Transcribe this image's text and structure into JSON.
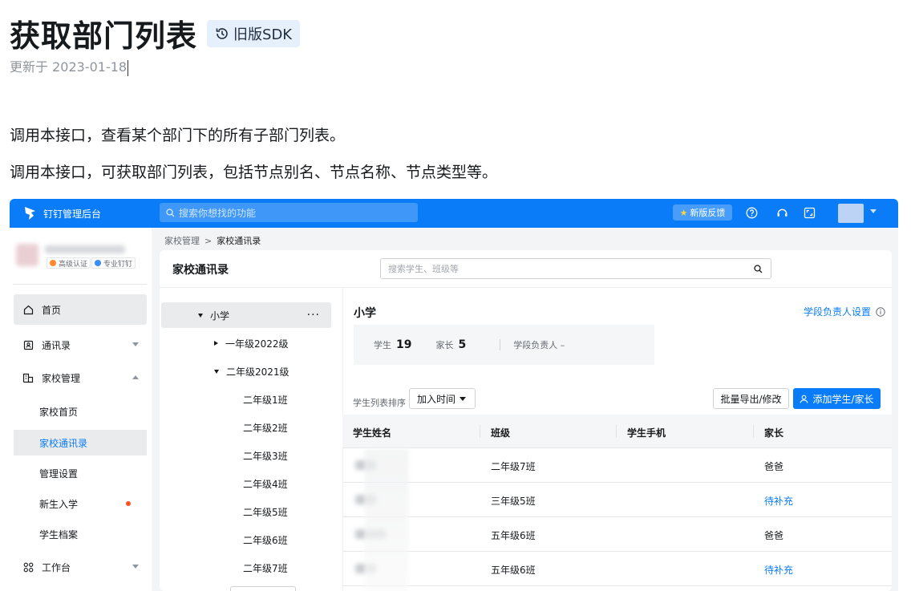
{
  "doc": {
    "title": "获取部门列表",
    "legacy_badge": "旧版SDK",
    "updated": "更新于 2023-01-18",
    "paragraphs": [
      "调用本接口，查看某个部门下的所有子部门列表。",
      "调用本接口，可获取部门列表，包括节点别名、节点名称、节点类型等。"
    ]
  },
  "app": {
    "name": "钉钉管理后台",
    "search_placeholder": "搜索你想找的功能",
    "feedback_label": "新版反馈",
    "accent_color": "#0a7cf7"
  },
  "sidebar": {
    "tags": [
      "高级认证",
      "专业钉钉"
    ],
    "nav": [
      {
        "label": "首页",
        "icon": "home-icon"
      },
      {
        "label": "通讯录",
        "icon": "contacts-icon"
      },
      {
        "label": "家校管理",
        "icon": "school-icon"
      },
      {
        "label": "工作台",
        "icon": "workbench-icon"
      }
    ],
    "sub_items": [
      "家校首页",
      "家校通讯录",
      "管理设置",
      "新生入学",
      "学生档案"
    ]
  },
  "breadcrumb": [
    "家校管理",
    "家校通讯录"
  ],
  "card": {
    "title": "家校通讯录",
    "search_placeholder": "搜索学生、班级等"
  },
  "tree": {
    "root": "小学",
    "more": "···",
    "grades": [
      "一年级2022级",
      "二年级2021级"
    ],
    "classes": [
      "二年级1班",
      "二年级2班",
      "二年级3班",
      "二年级4班",
      "二年级5班",
      "二年级6班",
      "二年级7班"
    ]
  },
  "panel": {
    "title": "小学",
    "stage_link": "学段负责人设置",
    "stats": {
      "student_label": "学生",
      "student_count": "19",
      "parent_label": "家长",
      "parent_count": "5",
      "head_label": "学段负责人 –"
    },
    "sort_label": "学生列表排序",
    "sort_value": "加入时间",
    "export_label": "批量导出/修改",
    "add_label": "添加学生/家长"
  },
  "table": {
    "columns": [
      "学生姓名",
      "班级",
      "学生手机",
      "家长"
    ],
    "rows": [
      {
        "class": "二年级7班",
        "parent": "爸爸",
        "parent_link": false
      },
      {
        "class": "三年级5班",
        "parent": "待补充",
        "parent_link": true
      },
      {
        "class": "五年级6班",
        "parent": "爸爸",
        "parent_link": false
      },
      {
        "class": "五年级6班",
        "parent": "待补充",
        "parent_link": true
      }
    ]
  }
}
